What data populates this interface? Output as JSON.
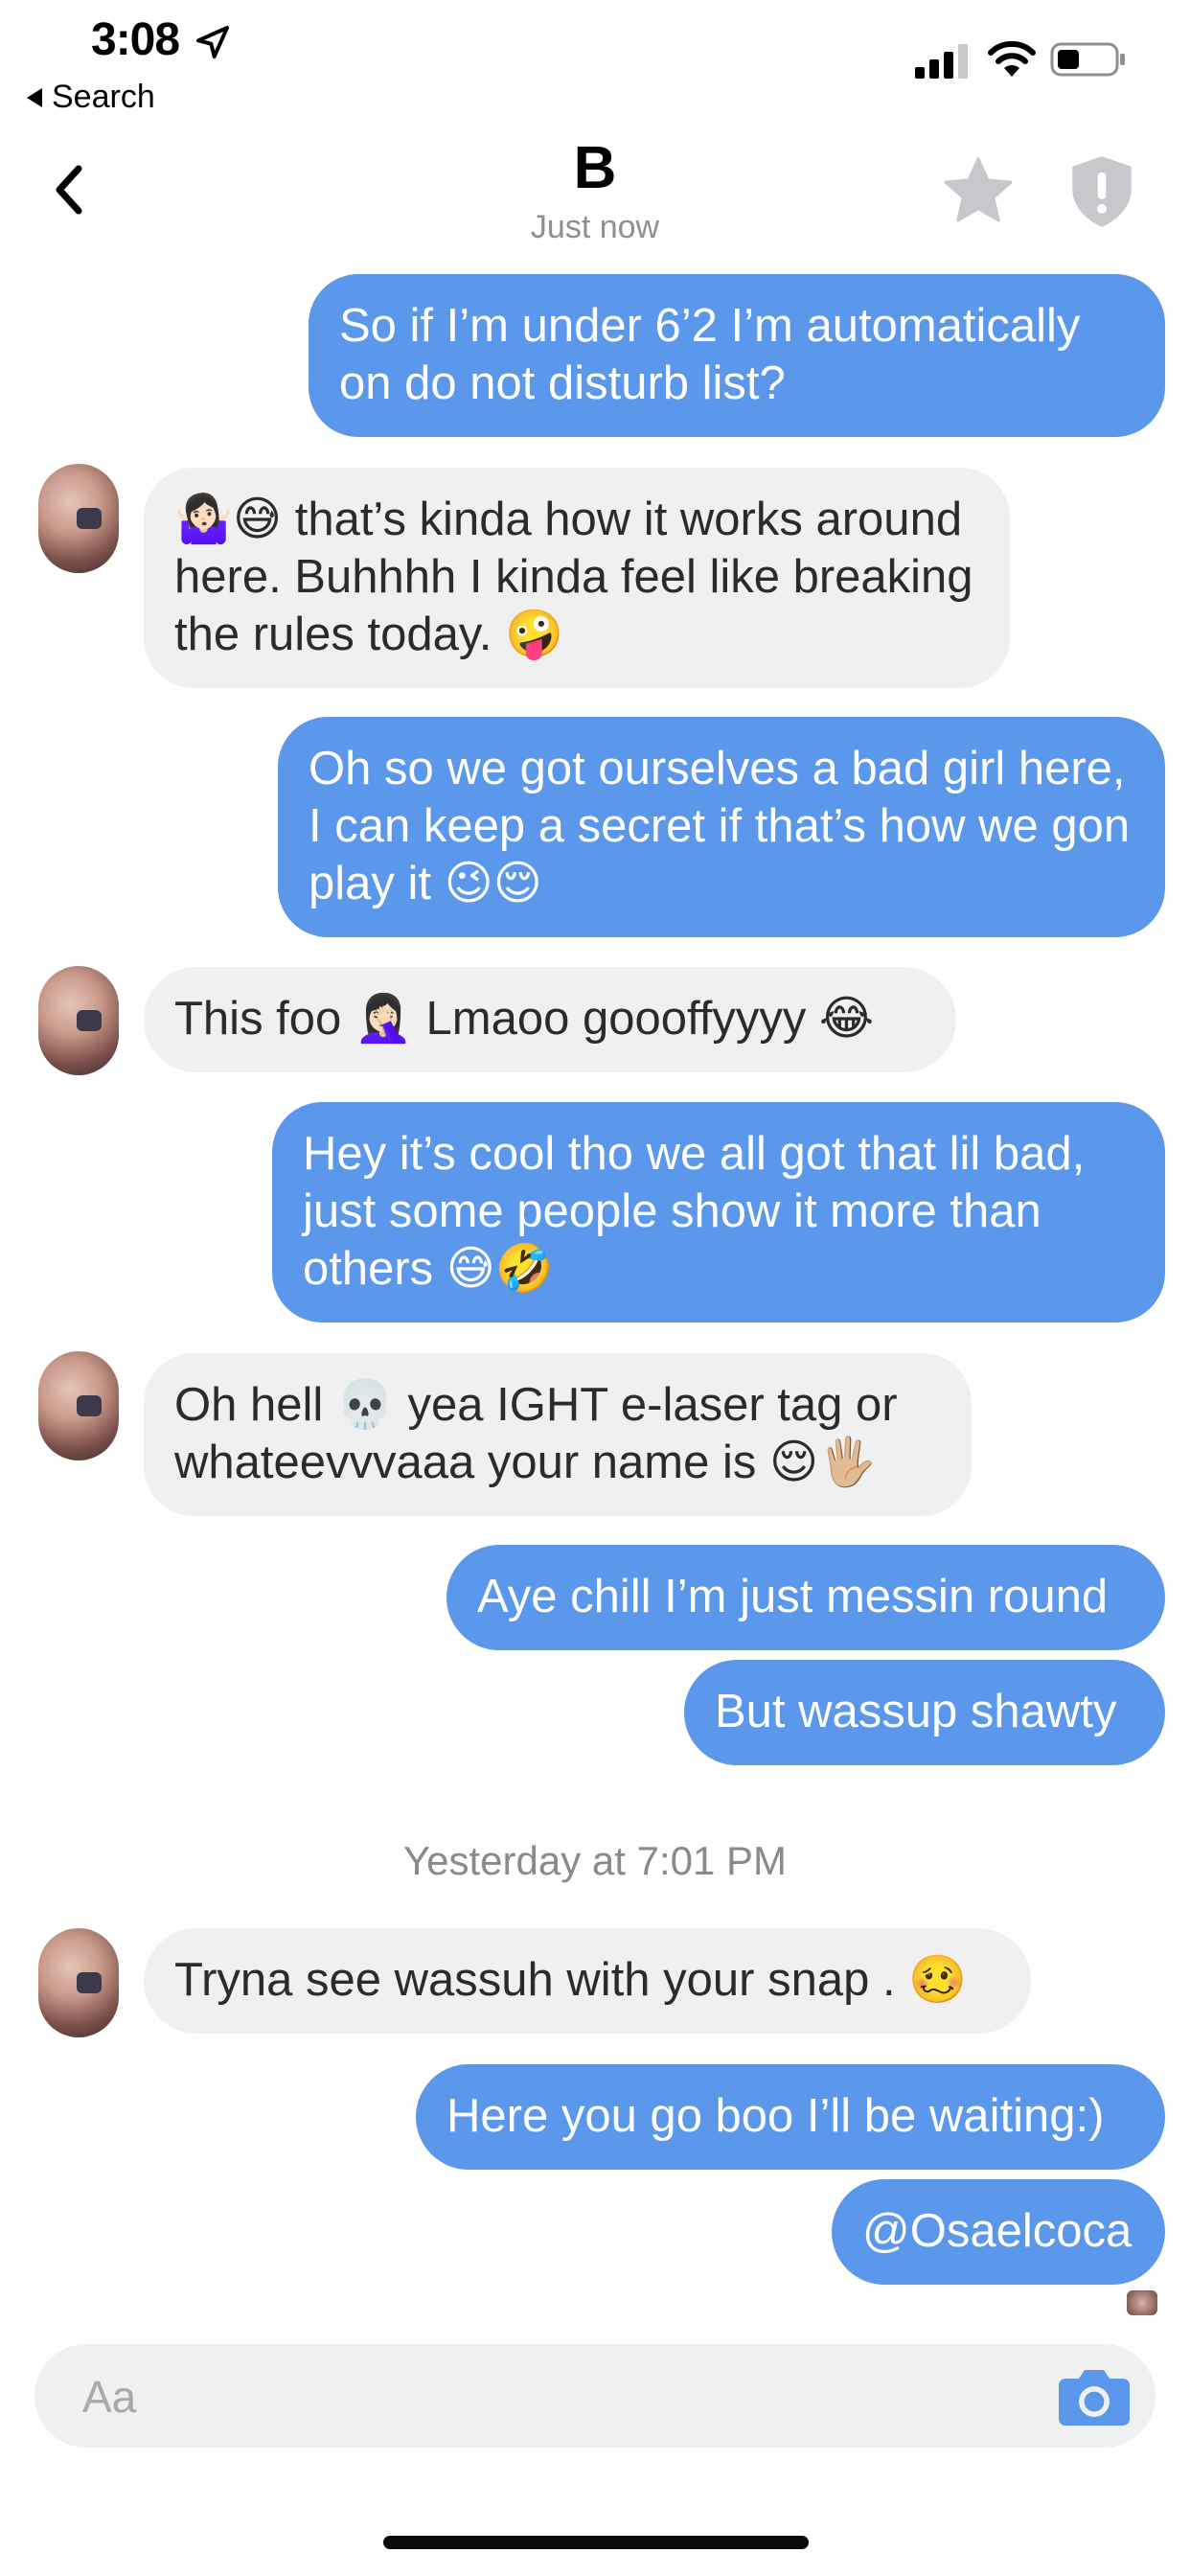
{
  "status_bar": {
    "time": "3:08",
    "back_label": "Search"
  },
  "header": {
    "name": "B",
    "status": "Just now"
  },
  "messages": [
    {
      "side": "out",
      "text": "So if I’m under 6’2 I’m automatically on do not disturb list?"
    },
    {
      "side": "in",
      "text": "🤷🏻‍♀️😅 that’s kinda how it works around here. Buhhhh I kinda feel like breaking the rules today. 🤪"
    },
    {
      "side": "out",
      "text": "Oh so we got ourselves a bad girl here, I can keep a secret if that’s how we gon play it 😉😌"
    },
    {
      "side": "in",
      "text": "This foo 🤦🏻‍♀️ Lmaoo goooffyyyy 😂"
    },
    {
      "side": "out",
      "text": "Hey it’s cool tho we all got that lil bad, just some people show it more than others 😅🤣"
    },
    {
      "side": "in",
      "text": "Oh hell 💀 yea IGHT e-laser tag or whateevvvaaa your name is 😌🖐🏼"
    },
    {
      "side": "out",
      "text": "Aye chill I’m just messin round"
    },
    {
      "side": "out",
      "text": "But wassup shawty"
    },
    {
      "side": "in",
      "text": "Tryna see wassuh with your snap . 🥴"
    },
    {
      "side": "out",
      "text": "Here you go boo I’ll be waiting:)"
    },
    {
      "side": "out",
      "text": "@Osaelcoca"
    }
  ],
  "separator": "Yesterday at 7:01 PM",
  "composer": {
    "placeholder": "Aa"
  },
  "colors": {
    "outgoing": "#5b97ea",
    "incoming": "#f0f0f0",
    "icon_gray": "#c7c7cc",
    "camera_blue": "#5b97ea"
  }
}
